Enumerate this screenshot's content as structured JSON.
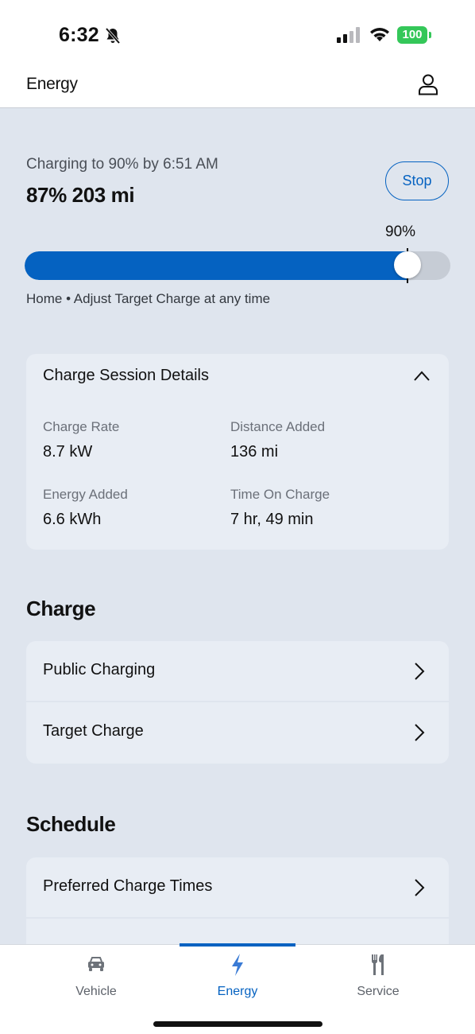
{
  "status_bar": {
    "time": "6:32",
    "battery": "100"
  },
  "header": {
    "title": "Energy"
  },
  "charging": {
    "status_text": "Charging to 90% by 6:51 AM",
    "summary": "87%  203 mi",
    "stop_label": "Stop",
    "target_label": "90%",
    "current_level": 0.87,
    "target_level": 0.9,
    "note": "Home • Adjust Target Charge at any time",
    "accent_color": "#0562c1"
  },
  "session_details": {
    "title": "Charge Session Details",
    "items": [
      {
        "label": "Charge Rate",
        "value": "8.7 kW"
      },
      {
        "label": "Distance Added",
        "value": "136 mi"
      },
      {
        "label": "Energy Added",
        "value": "6.6 kWh"
      },
      {
        "label": "Time On Charge",
        "value": "7 hr, 49 min"
      }
    ]
  },
  "charge_section": {
    "heading": "Charge",
    "items": [
      {
        "label": "Public Charging"
      },
      {
        "label": "Target Charge"
      }
    ]
  },
  "schedule_section": {
    "heading": "Schedule",
    "items": [
      {
        "label": "Preferred Charge Times"
      }
    ]
  },
  "bottom_nav": {
    "items": [
      {
        "label": "Vehicle",
        "icon": "car-icon"
      },
      {
        "label": "Energy",
        "icon": "lightning-icon",
        "active": true
      },
      {
        "label": "Service",
        "icon": "tools-icon"
      }
    ]
  }
}
